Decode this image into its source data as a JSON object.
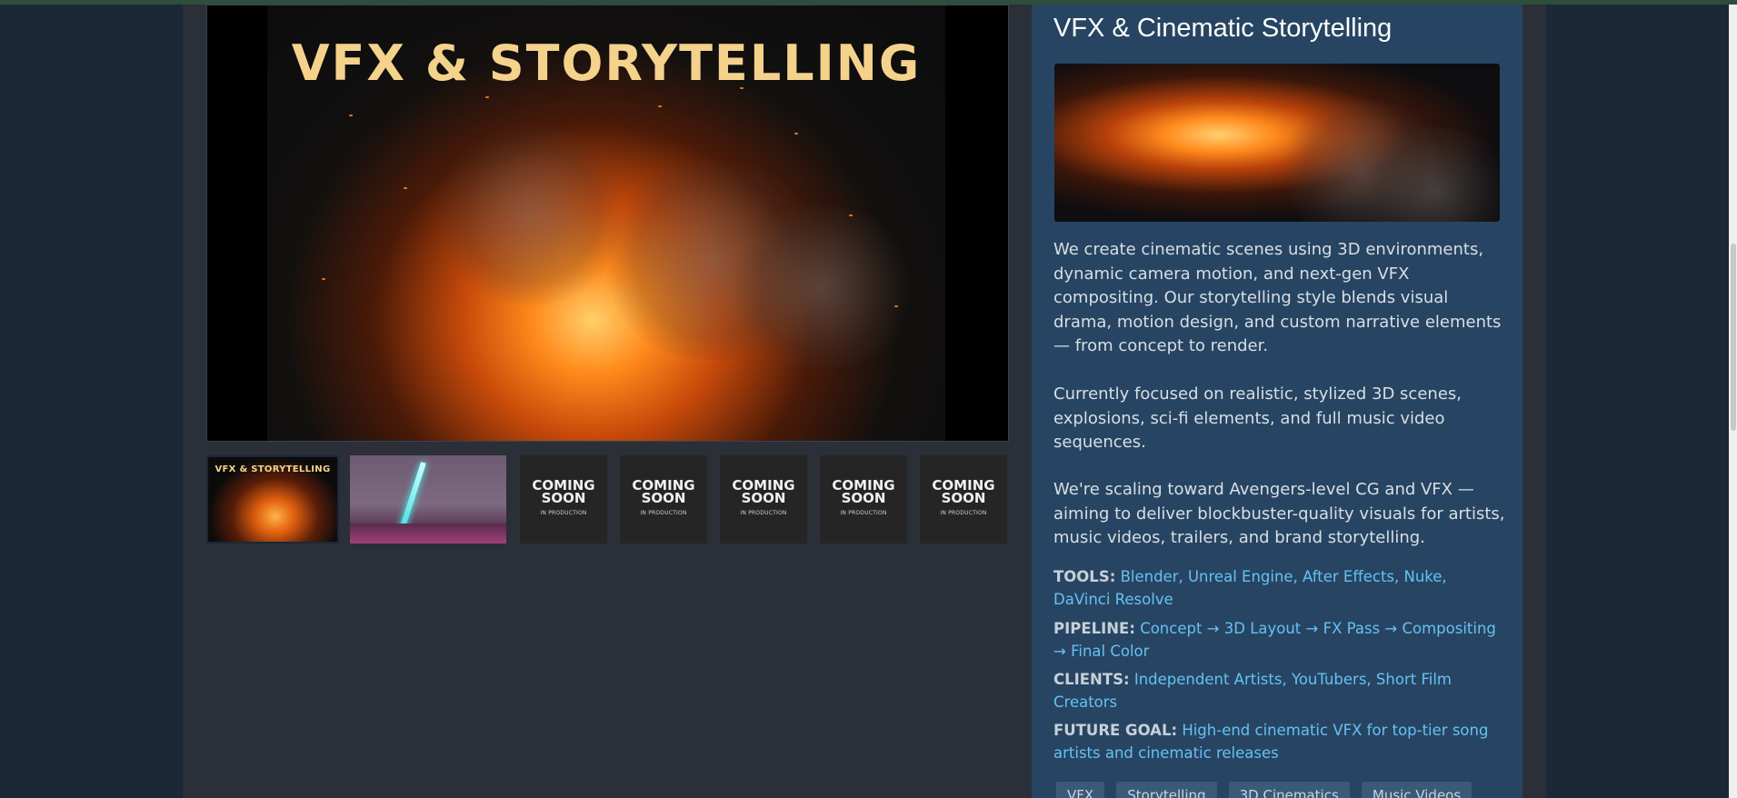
{
  "viewer": {
    "main_title": "VFX & STORYTELLING"
  },
  "thumbnails": [
    {
      "type": "image",
      "title": "VFX & STORYTELLING"
    },
    {
      "type": "image"
    },
    {
      "type": "placeholder",
      "big": "COMING\nSOON",
      "small": "IN PRODUCTION"
    },
    {
      "type": "placeholder",
      "big": "COMING\nSOON",
      "small": "IN PRODUCTION"
    },
    {
      "type": "placeholder",
      "big": "COMING\nSOON",
      "small": "IN PRODUCTION"
    },
    {
      "type": "placeholder",
      "big": "COMING\nSOON",
      "small": "IN PRODUCTION"
    },
    {
      "type": "placeholder",
      "big": "COMING\nSOON",
      "small": "IN PRODUCTION"
    }
  ],
  "panel": {
    "title": "VFX & Cinematic Storytelling",
    "paragraphs": [
      "We create cinematic scenes using 3D environments, dynamic camera motion, and next-gen VFX compositing. Our storytelling style blends visual drama, motion design, and custom narrative elements — from concept to render.",
      "Currently focused on realistic, stylized 3D scenes, explosions, sci-fi elements, and full music video sequences.",
      "We're scaling toward Avengers-level CG and VFX — aiming to deliver blockbuster-quality visuals for artists, music videos, trailers, and brand storytelling."
    ],
    "tools_label": "TOOLS:",
    "tools_value": "Blender, Unreal Engine, After Effects, Nuke, DaVinci Resolve",
    "pipeline_label": "PIPELINE:",
    "pipeline_value": "Concept → 3D Layout → FX Pass → Compositing → Final Color",
    "clients_label": "CLIENTS:",
    "clients_value": "Independent Artists, YouTubers, Short Film Creators",
    "goal_label": "FUTURE GOAL:",
    "goal_value": "High-end cinematic VFX for top-tier song artists and cinematic releases",
    "tags": [
      "VFX",
      "Storytelling",
      "3D Cinematics",
      "Music Videos"
    ]
  },
  "colors": {
    "background": "#1b2838",
    "panel": "#274562",
    "link": "#66c0f4",
    "title_gold": "#f5d28c"
  }
}
